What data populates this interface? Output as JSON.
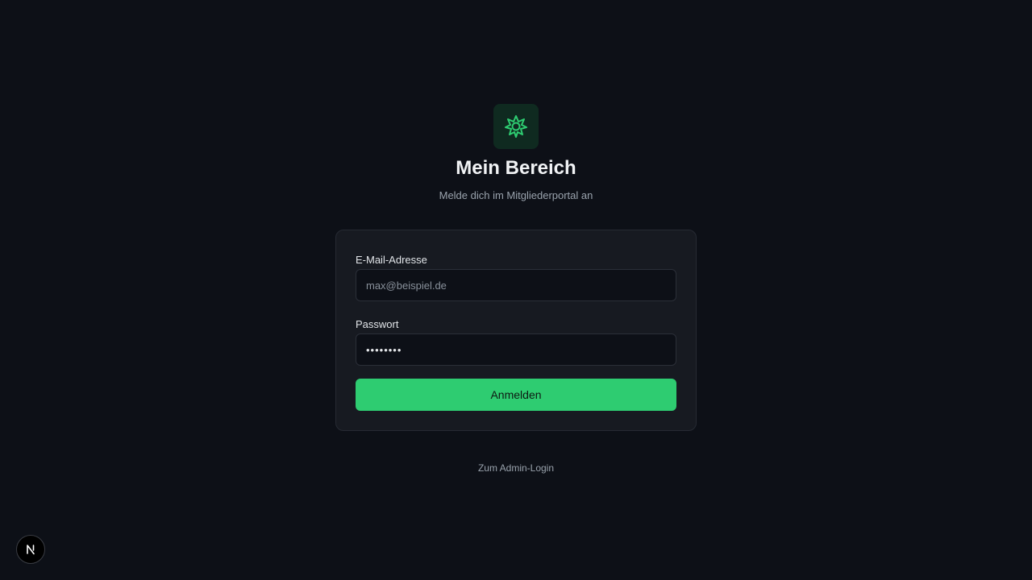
{
  "brand": {
    "icon": "leaf-icon",
    "accent_color": "#2ecc71",
    "icon_bg": "#0f2a20"
  },
  "header": {
    "title": "Mein Bereich",
    "subtitle": "Melde dich im Mitgliederportal an"
  },
  "form": {
    "email": {
      "label": "E-Mail-Adresse",
      "placeholder": "max@beispiel.de",
      "value": ""
    },
    "password": {
      "label": "Passwort",
      "value": "12345678"
    },
    "submit_label": "Anmelden"
  },
  "footer": {
    "admin_link": "Zum Admin-Login"
  },
  "devtools": {
    "icon": "nextjs-icon"
  }
}
